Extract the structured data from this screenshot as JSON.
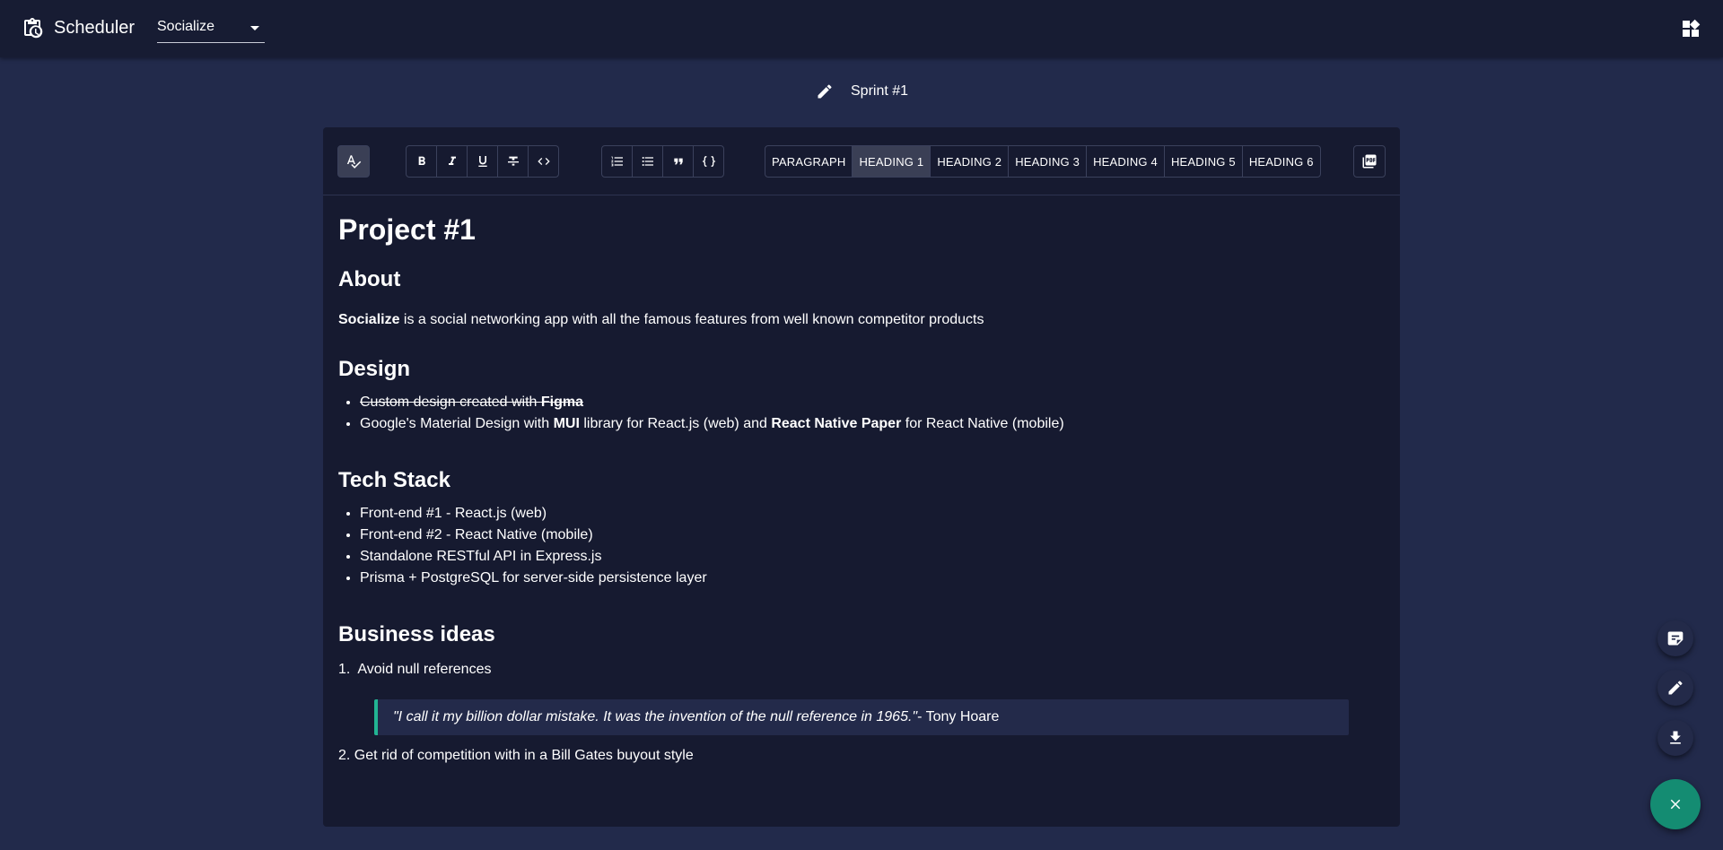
{
  "appbar": {
    "title": "Scheduler",
    "project_select": {
      "value": "Socialize"
    },
    "icons": {
      "app": "clipboard-clock-icon",
      "apps": "widgets-icon"
    }
  },
  "sprint": {
    "title": "Sprint #1"
  },
  "toolbar": {
    "spellcheck_icon": "spellcheck-icon",
    "format_buttons": [
      "bold-icon",
      "italic-icon",
      "underline-icon",
      "strikethrough-icon",
      "code-icon"
    ],
    "block_buttons": [
      "ordered-list-icon",
      "bullet-list-icon",
      "quote-icon",
      "code-block-icon"
    ],
    "heading_options": [
      "PARAGRAPH",
      "HEADING 1",
      "HEADING 2",
      "HEADING 3",
      "HEADING 4",
      "HEADING 5",
      "HEADING 6"
    ],
    "selected_heading": "HEADING 1",
    "pdf_icon": "pdf-icon"
  },
  "doc": {
    "h1": "Project #1",
    "about_heading": "About",
    "about_bold": "Socialize",
    "about_text": " is a social networking app with all the famous features from well known competitor products",
    "design_heading": "Design",
    "design_item1_text": "Custom design created with ",
    "design_item1_bold": "Figma",
    "design_item2_a": "Google's Material Design with ",
    "design_item2_b": "MUI",
    "design_item2_c": " library for React.js (web) and ",
    "design_item2_d": "React Native Paper",
    "design_item2_e": " for React Native (mobile)",
    "tech_heading": "Tech Stack",
    "tech_items": [
      "Front-end #1 - React.js (web)",
      "Front-end #2 - React Native (mobile)",
      "Standalone RESTful API in Express.js",
      "Prisma + PostgreSQL for server-side persistence layer"
    ],
    "business_heading": "Business ideas",
    "business_item1": "1.  Avoid null references",
    "quote_italic": "\"I call it my billion dollar mistake. It was the invention of the null reference in 1965.\"",
    "quote_author": " - Tony Hoare",
    "business_item2": "2. Get rid of competition with in a Bill Gates buyout style"
  },
  "fabs": [
    "note-icon",
    "edit-icon",
    "download-icon",
    "close-icon"
  ],
  "colors": {
    "accent": "#22b493",
    "fab_main": "#148c72",
    "background": "#222a4b",
    "surface": "#161a30"
  }
}
